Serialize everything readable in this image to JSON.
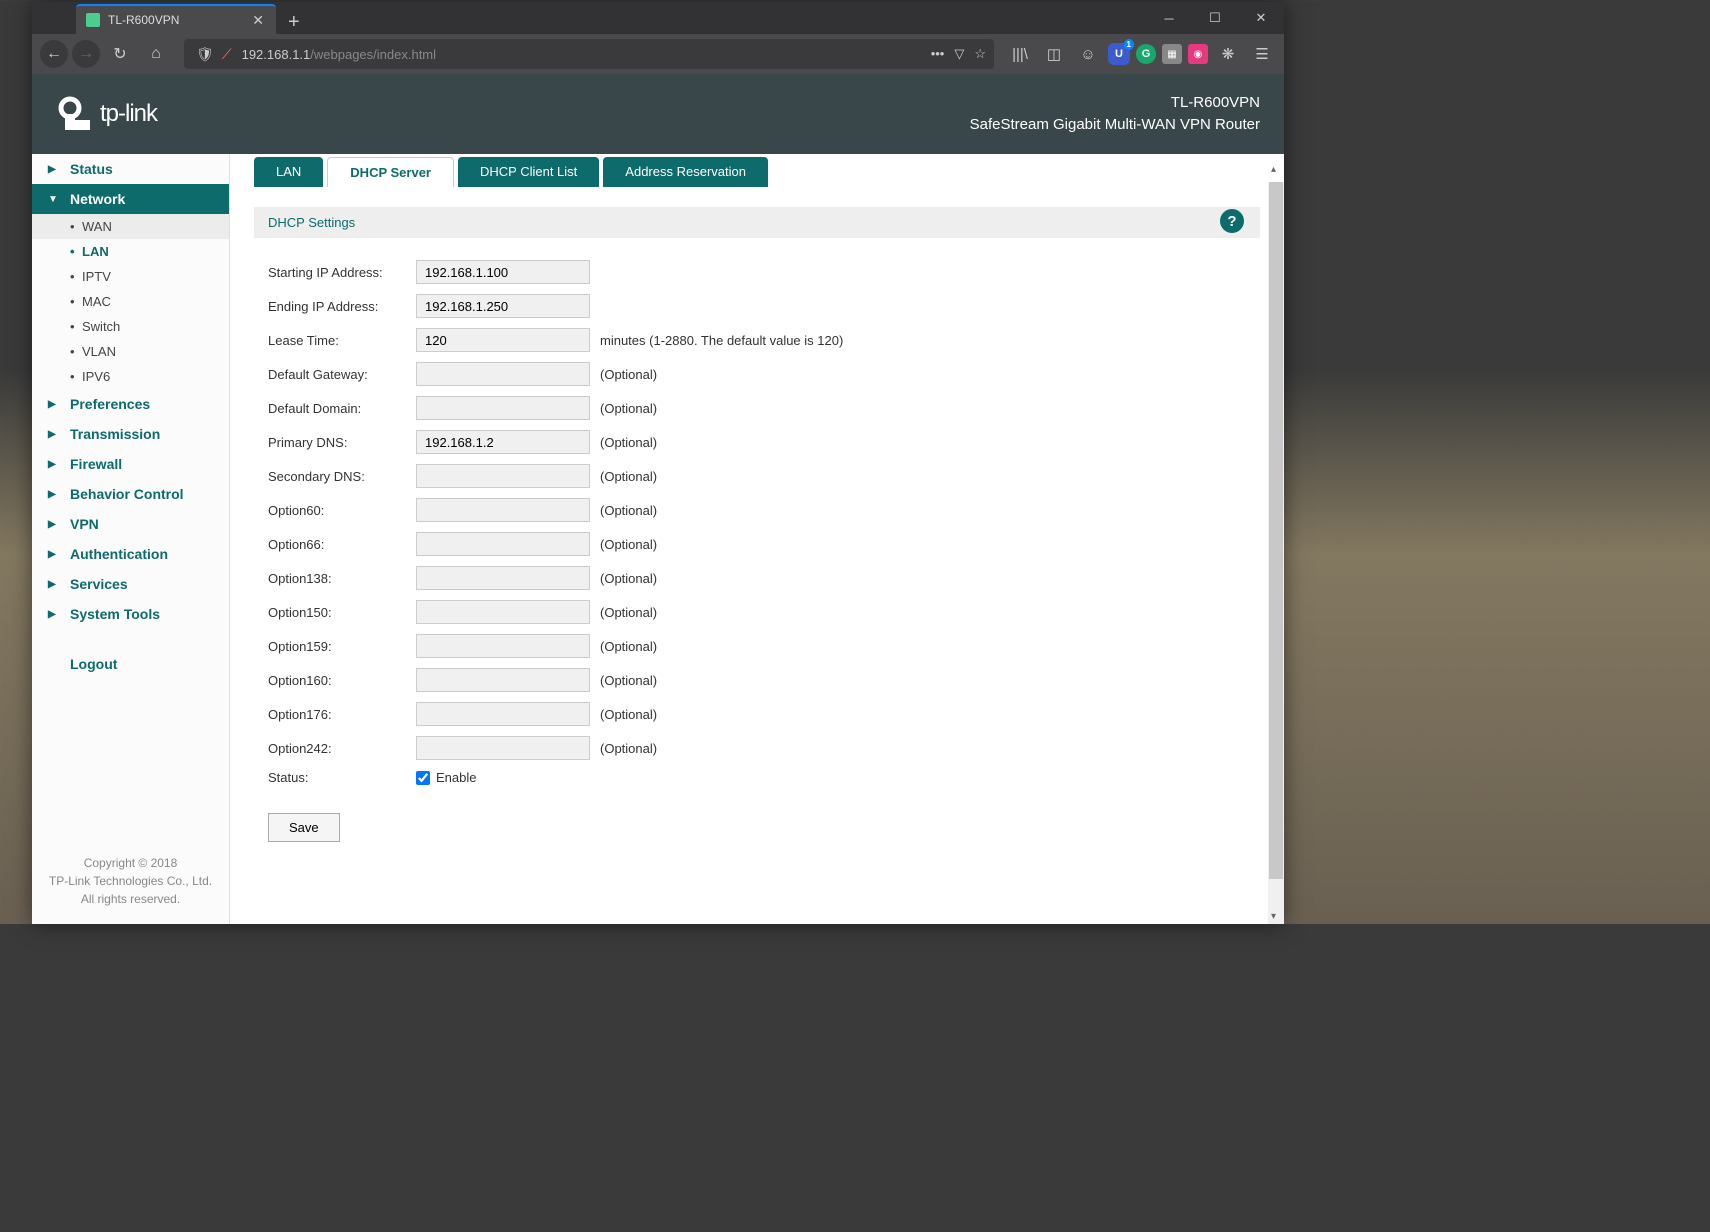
{
  "browser": {
    "tab_title": "TL-R600VPN",
    "url_host": "192.168.1.1",
    "url_path": "/webpages/index.html"
  },
  "header": {
    "brand": "tp-link",
    "model": "TL-R600VPN",
    "product": "SafeStream Gigabit Multi-WAN VPN Router"
  },
  "sidebar": {
    "items": [
      {
        "label": "Status",
        "expanded": false
      },
      {
        "label": "Network",
        "expanded": true,
        "children": [
          {
            "label": "WAN"
          },
          {
            "label": "LAN",
            "selected": true
          },
          {
            "label": "IPTV"
          },
          {
            "label": "MAC"
          },
          {
            "label": "Switch"
          },
          {
            "label": "VLAN"
          },
          {
            "label": "IPV6"
          }
        ]
      },
      {
        "label": "Preferences"
      },
      {
        "label": "Transmission"
      },
      {
        "label": "Firewall"
      },
      {
        "label": "Behavior Control"
      },
      {
        "label": "VPN"
      },
      {
        "label": "Authentication"
      },
      {
        "label": "Services"
      },
      {
        "label": "System Tools"
      }
    ],
    "logout": "Logout"
  },
  "footer": {
    "line1": "Copyright © 2018",
    "line2": "TP-Link Technologies Co., Ltd.",
    "line3": "All rights reserved."
  },
  "tabs": [
    {
      "label": "LAN"
    },
    {
      "label": "DHCP Server",
      "active": true
    },
    {
      "label": "DHCP Client List"
    },
    {
      "label": "Address Reservation"
    }
  ],
  "section_title": "DHCP Settings",
  "form": {
    "starting_ip": {
      "label": "Starting IP Address:",
      "value": "192.168.1.100"
    },
    "ending_ip": {
      "label": "Ending IP Address:",
      "value": "192.168.1.250"
    },
    "lease_time": {
      "label": "Lease Time:",
      "value": "120",
      "hint": "minutes (1-2880. The default value is 120)"
    },
    "default_gateway": {
      "label": "Default Gateway:",
      "value": "",
      "hint": "(Optional)"
    },
    "default_domain": {
      "label": "Default Domain:",
      "value": "",
      "hint": "(Optional)"
    },
    "primary_dns": {
      "label": "Primary DNS:",
      "value": "192.168.1.2",
      "hint": "(Optional)"
    },
    "secondary_dns": {
      "label": "Secondary DNS:",
      "value": "",
      "hint": "(Optional)"
    },
    "option60": {
      "label": "Option60:",
      "value": "",
      "hint": "(Optional)"
    },
    "option66": {
      "label": "Option66:",
      "value": "",
      "hint": "(Optional)"
    },
    "option138": {
      "label": "Option138:",
      "value": "",
      "hint": "(Optional)"
    },
    "option150": {
      "label": "Option150:",
      "value": "",
      "hint": "(Optional)"
    },
    "option159": {
      "label": "Option159:",
      "value": "",
      "hint": "(Optional)"
    },
    "option160": {
      "label": "Option160:",
      "value": "",
      "hint": "(Optional)"
    },
    "option176": {
      "label": "Option176:",
      "value": "",
      "hint": "(Optional)"
    },
    "option242": {
      "label": "Option242:",
      "value": "",
      "hint": "(Optional)"
    },
    "status": {
      "label": "Status:",
      "checkbox_label": "Enable",
      "checked": true
    }
  },
  "save_label": "Save"
}
